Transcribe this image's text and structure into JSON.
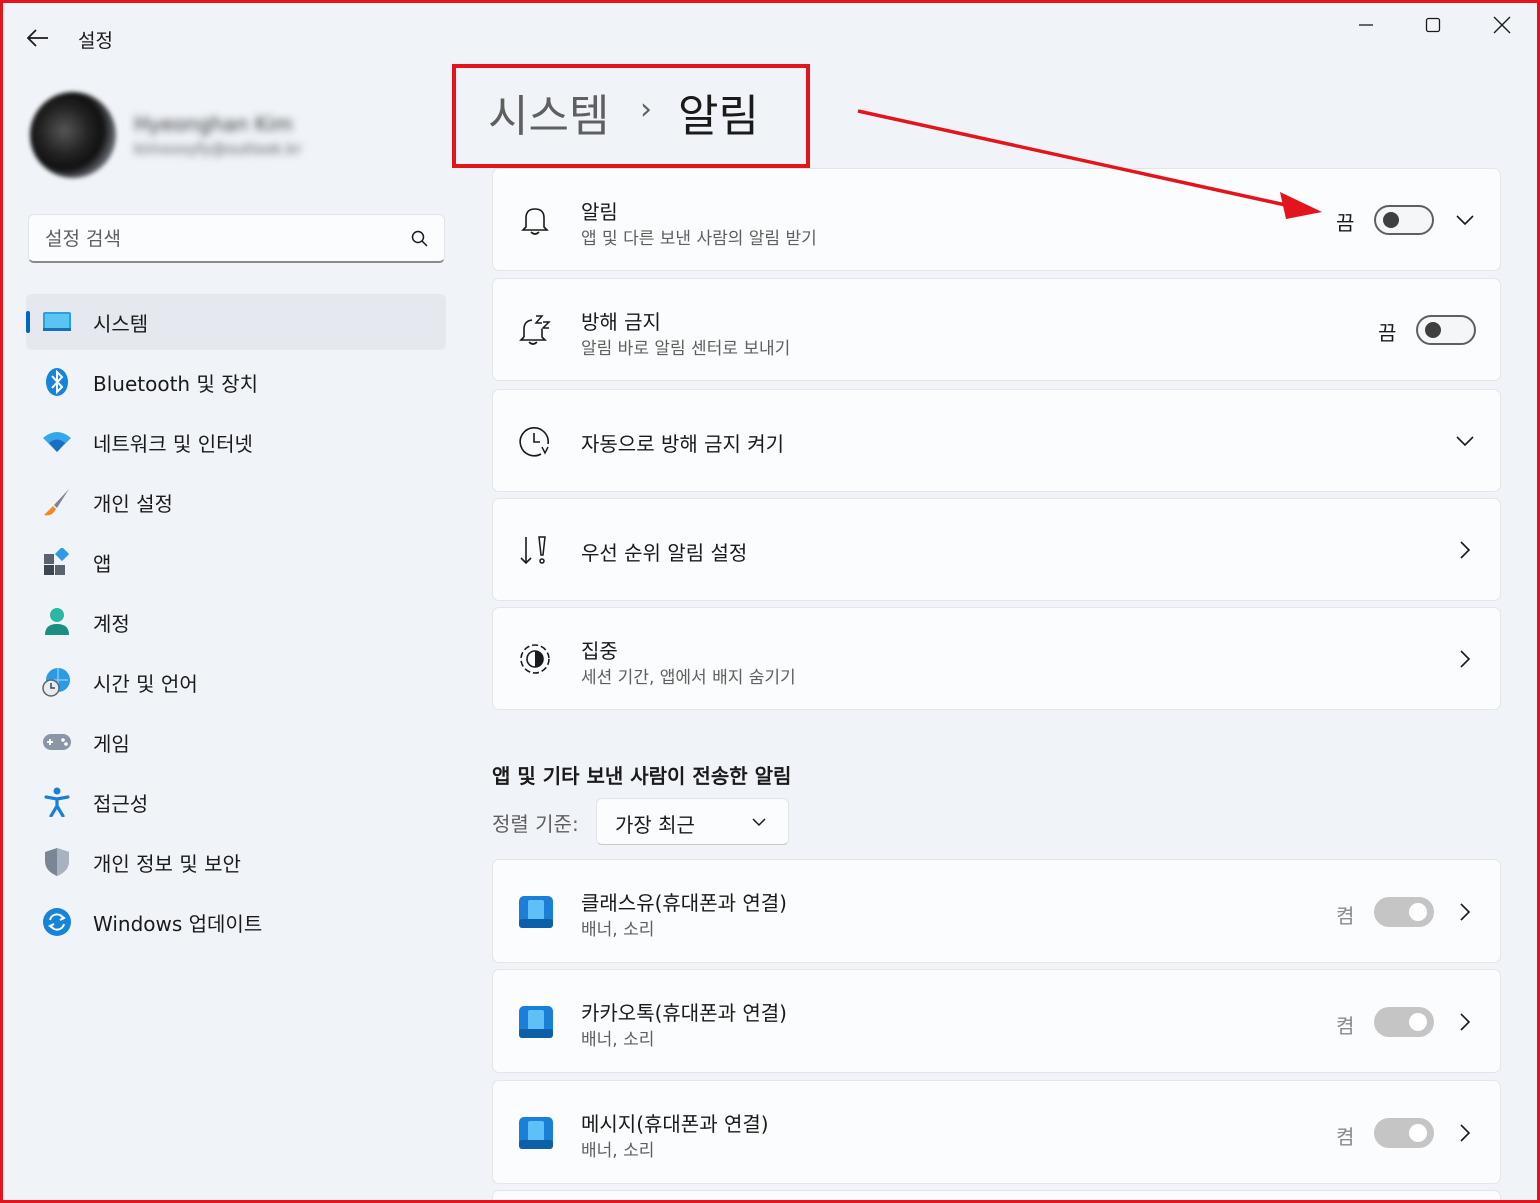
{
  "window": {
    "title": "설정"
  },
  "profile": {
    "name": "Hyeonghan Kim",
    "email": "kimxxxyfy@outlook.kr"
  },
  "search": {
    "placeholder": "설정 검색"
  },
  "nav": {
    "items": [
      {
        "label": "시스템",
        "icon": "system-icon",
        "active": true
      },
      {
        "label": "Bluetooth 및 장치",
        "icon": "bluetooth-icon"
      },
      {
        "label": "네트워크 및 인터넷",
        "icon": "wifi-icon"
      },
      {
        "label": "개인 설정",
        "icon": "brush-icon"
      },
      {
        "label": "앱",
        "icon": "apps-icon"
      },
      {
        "label": "계정",
        "icon": "account-icon"
      },
      {
        "label": "시간 및 언어",
        "icon": "globe-clock-icon"
      },
      {
        "label": "게임",
        "icon": "gamepad-icon"
      },
      {
        "label": "접근성",
        "icon": "accessibility-icon"
      },
      {
        "label": "개인 정보 및 보안",
        "icon": "shield-icon"
      },
      {
        "label": "Windows 업데이트",
        "icon": "update-icon"
      }
    ]
  },
  "breadcrumb": {
    "parent": "시스템",
    "separator": "›",
    "current": "알림"
  },
  "settings": {
    "notifications": {
      "title": "알림",
      "subtitle": "앱 및 다른 보낸 사람의 알림 받기",
      "state": "끔",
      "on": false
    },
    "dnd": {
      "title": "방해 금지",
      "subtitle": "알림 바로 알림 센터로 보내기",
      "state": "끔",
      "on": false
    },
    "auto_dnd": {
      "title": "자동으로 방해 금지 켜기"
    },
    "priority": {
      "title": "우선 순위 알림 설정"
    },
    "focus": {
      "title": "집중",
      "subtitle": "세션 기간, 앱에서 배지 숨기기"
    }
  },
  "apps_section": {
    "title": "앱 및 기타 보낸 사람이 전송한 알림",
    "sort_label": "정렬 기준:",
    "sort_value": "가장 최근",
    "apps": [
      {
        "name": "클래스유(휴대폰과 연결)",
        "detail": "배너, 소리",
        "state": "켬"
      },
      {
        "name": "카카오톡(휴대폰과 연결)",
        "detail": "배너, 소리",
        "state": "켬"
      },
      {
        "name": "메시지(휴대폰과 연결)",
        "detail": "배너, 소리",
        "state": "켬"
      }
    ]
  },
  "colors": {
    "accent": "#0067c0",
    "annotation": "#e3141b"
  }
}
